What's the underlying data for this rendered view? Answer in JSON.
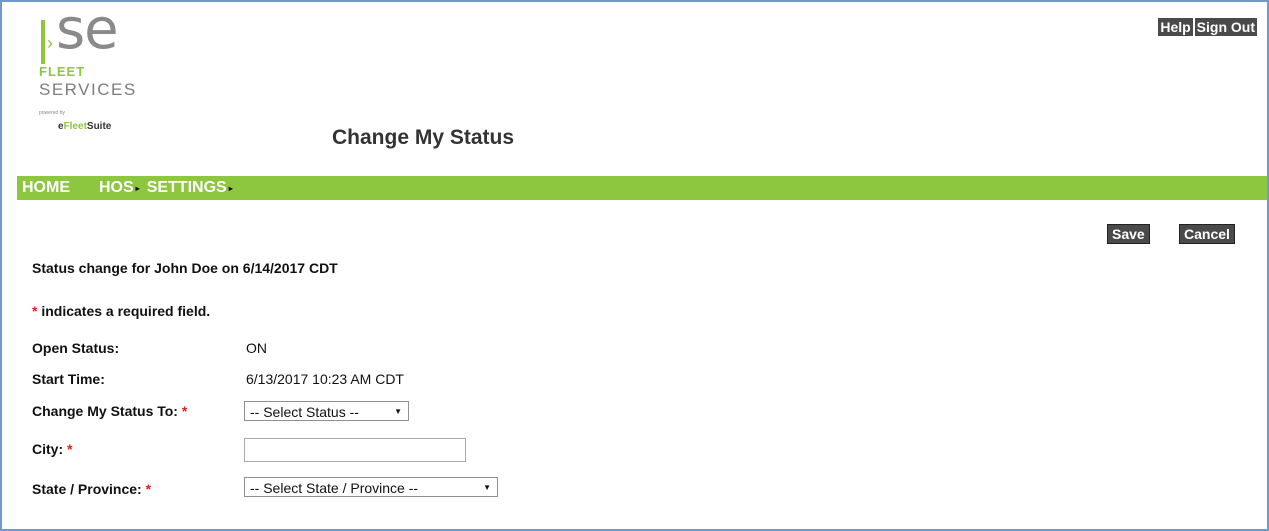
{
  "logo": {
    "mark_text": "se",
    "fleet": "FLEET",
    "services": "SERVICES",
    "powered": "powered by",
    "efleet_prefix": "e",
    "efleet_highlight": "Fleet",
    "efleet_suffix": "Suite"
  },
  "header": {
    "title": "Change My Status",
    "links": [
      "Help",
      "Sign Out"
    ]
  },
  "nav": {
    "items": [
      {
        "label": "HOME",
        "has_submenu": false
      },
      {
        "label": "HOS",
        "has_submenu": true
      },
      {
        "label": "SETTINGS",
        "has_submenu": true
      }
    ],
    "submenu_arrow": "▸"
  },
  "actions": {
    "save_label": "Save",
    "cancel_label": "Cancel"
  },
  "form": {
    "status_line": "Status change for John Doe on 6/14/2017 CDT",
    "required_star": "*",
    "required_note": " indicates a required field.",
    "open_status_label": "Open Status:",
    "open_status_value": "ON",
    "start_time_label": "Start Time:",
    "start_time_value": "6/13/2017 10:23 AM CDT",
    "change_status_label": "Change My Status To:",
    "change_status_selected": "-- Select Status --",
    "city_label": "City:",
    "city_value": "",
    "state_label": "State / Province:",
    "state_selected": "-- Select State / Province --"
  },
  "colors": {
    "nav_green": "#8dc63f",
    "button_bg": "#4a4a4a",
    "required_red": "#e02020",
    "frame_border": "#6f9ac9"
  }
}
